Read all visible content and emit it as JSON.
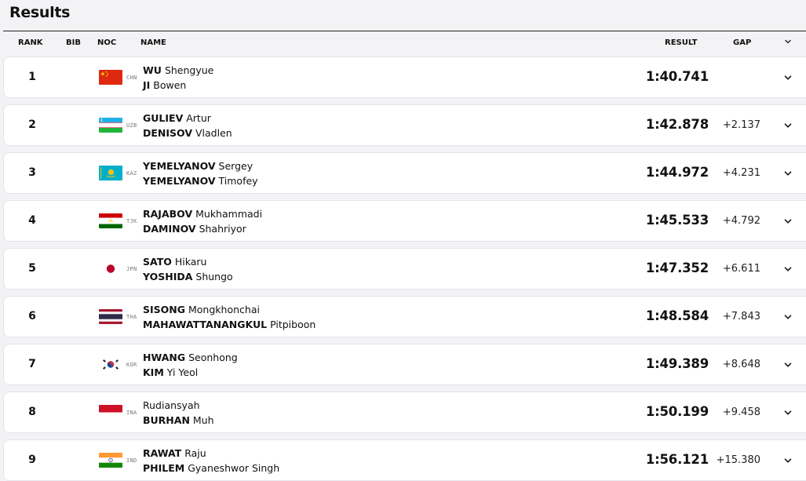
{
  "page": {
    "title": "Results"
  },
  "columns": {
    "rank": "RANK",
    "bib": "BIB",
    "noc": "NOC",
    "name": "NAME",
    "result": "RESULT",
    "gap": "GAP"
  },
  "rows": [
    {
      "rank": "1",
      "noc": "CHN",
      "flag": "china-flag",
      "athletes": [
        {
          "last": "WU",
          "first": "Shengyue"
        },
        {
          "last": "JI",
          "first": "Bowen"
        }
      ],
      "result": "1:40.741",
      "gap": ""
    },
    {
      "rank": "2",
      "noc": "UZB",
      "flag": "uzbekistan-flag",
      "athletes": [
        {
          "last": "GULIEV",
          "first": "Artur"
        },
        {
          "last": "DENISOV",
          "first": "Vladlen"
        }
      ],
      "result": "1:42.878",
      "gap": "+2.137"
    },
    {
      "rank": "3",
      "noc": "KAZ",
      "flag": "kazakhstan-flag",
      "athletes": [
        {
          "last": "YEMELYANOV",
          "first": "Sergey"
        },
        {
          "last": "YEMELYANOV",
          "first": "Timofey"
        }
      ],
      "result": "1:44.972",
      "gap": "+4.231"
    },
    {
      "rank": "4",
      "noc": "TJK",
      "flag": "tajikistan-flag",
      "athletes": [
        {
          "last": "RAJABOV",
          "first": "Mukhammadi"
        },
        {
          "last": "DAMINOV",
          "first": "Shahriyor"
        }
      ],
      "result": "1:45.533",
      "gap": "+4.792"
    },
    {
      "rank": "5",
      "noc": "JPN",
      "flag": "japan-flag",
      "athletes": [
        {
          "last": "SATO",
          "first": "Hikaru"
        },
        {
          "last": "YOSHIDA",
          "first": "Shungo"
        }
      ],
      "result": "1:47.352",
      "gap": "+6.611"
    },
    {
      "rank": "6",
      "noc": "THA",
      "flag": "thailand-flag",
      "athletes": [
        {
          "last": "SISONG",
          "first": "Mongkhonchai"
        },
        {
          "last": "MAHAWATTANANGKUL",
          "first": "Pitpiboon"
        }
      ],
      "result": "1:48.584",
      "gap": "+7.843"
    },
    {
      "rank": "7",
      "noc": "KOR",
      "flag": "korea-flag",
      "athletes": [
        {
          "last": "HWANG",
          "first": "Seonhong"
        },
        {
          "last": "KIM",
          "first": "Yi Yeol"
        }
      ],
      "result": "1:49.389",
      "gap": "+8.648"
    },
    {
      "rank": "8",
      "noc": "INA",
      "flag": "indonesia-flag",
      "athletes": [
        {
          "last": "",
          "first": "Rudiansyah"
        },
        {
          "last": "BURHAN",
          "first": "Muh"
        }
      ],
      "result": "1:50.199",
      "gap": "+9.458"
    },
    {
      "rank": "9",
      "noc": "IND",
      "flag": "india-flag",
      "athletes": [
        {
          "last": "RAWAT",
          "first": "Raju"
        },
        {
          "last": "PHILEM",
          "first": "Gyaneshwor Singh"
        }
      ],
      "result": "1:56.121",
      "gap": "+15.380"
    }
  ],
  "icons": {
    "expand": "chevron-down-icon"
  }
}
